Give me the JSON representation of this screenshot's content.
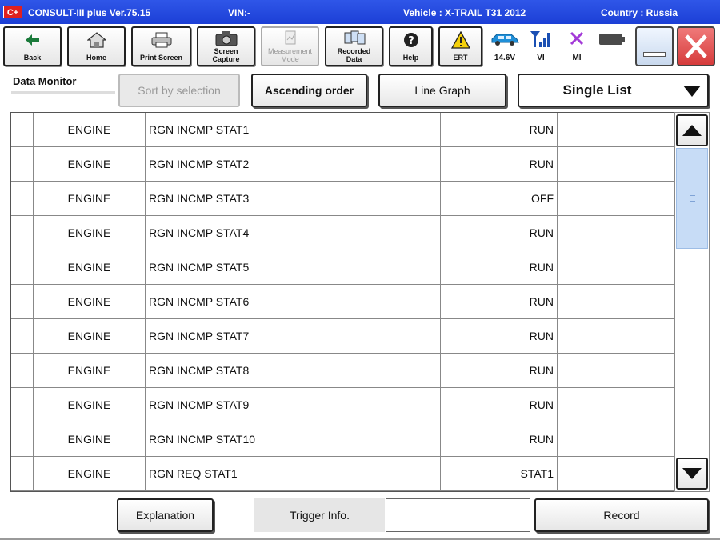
{
  "titlebar": {
    "logo": "C+",
    "app": "CONSULT-III plus  Ver.75.15",
    "vin": "VIN:-",
    "vehicle": "Vehicle : X-TRAIL T31 2012",
    "country": "Country : Russia"
  },
  "toolbar": {
    "back": "Back",
    "home": "Home",
    "print_screen": "Print Screen",
    "screen_capture": "Screen\nCapture",
    "measurement_mode": "Measurement\nMode",
    "recorded_data": "Recorded\nData",
    "help": "Help",
    "ert": "ERT",
    "voltage": "14.6V",
    "vi": "VI",
    "mi": "MI"
  },
  "header": {
    "title": "Data Monitor",
    "sort_button": "Sort by selection",
    "ascending_button": "Ascending order",
    "line_graph_button": "Line Graph",
    "list_mode": "Single List"
  },
  "table": {
    "rows": [
      {
        "system": "ENGINE",
        "item": "RGN INCMP STAT1",
        "value": "RUN",
        "unit": ""
      },
      {
        "system": "ENGINE",
        "item": "RGN INCMP STAT2",
        "value": "RUN",
        "unit": ""
      },
      {
        "system": "ENGINE",
        "item": "RGN INCMP STAT3",
        "value": "OFF",
        "unit": ""
      },
      {
        "system": "ENGINE",
        "item": "RGN INCMP STAT4",
        "value": "RUN",
        "unit": ""
      },
      {
        "system": "ENGINE",
        "item": "RGN INCMP STAT5",
        "value": "RUN",
        "unit": ""
      },
      {
        "system": "ENGINE",
        "item": "RGN INCMP STAT6",
        "value": "RUN",
        "unit": ""
      },
      {
        "system": "ENGINE",
        "item": "RGN INCMP STAT7",
        "value": "RUN",
        "unit": ""
      },
      {
        "system": "ENGINE",
        "item": "RGN INCMP STAT8",
        "value": "RUN",
        "unit": ""
      },
      {
        "system": "ENGINE",
        "item": "RGN INCMP STAT9",
        "value": "RUN",
        "unit": ""
      },
      {
        "system": "ENGINE",
        "item": "RGN INCMP STAT10",
        "value": "RUN",
        "unit": ""
      },
      {
        "system": "ENGINE",
        "item": "RGN REQ STAT1",
        "value": "STAT1",
        "unit": ""
      }
    ]
  },
  "footer": {
    "explanation": "Explanation",
    "trigger_label": "Trigger Info.",
    "trigger_value": "",
    "record": "Record"
  },
  "colors": {
    "titlebar": "#1c3fd6",
    "close_red": "#e04a4a",
    "scroll_thumb": "#c7dcf6",
    "car_blue": "#1f8fd8",
    "vi_blue": "#1a4fb3",
    "mi_purple": "#a33ad8"
  }
}
